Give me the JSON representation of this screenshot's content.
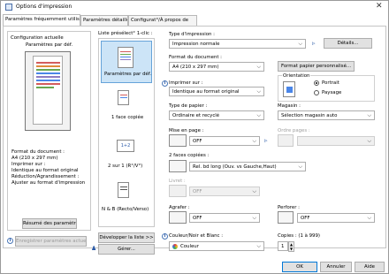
{
  "window": {
    "title": "Options d'impression"
  },
  "tabs": [
    {
      "label": "Paramètres fréquemment utilisés"
    },
    {
      "label": "Paramètres détaillés"
    },
    {
      "label": "Configurat°/À propos de"
    }
  ],
  "left_panel": {
    "heading": "Configuration actuelle",
    "preview_caption": "Paramètres par déf.",
    "summary_lines": [
      "Format du document :",
      "  A4 (210 x 297 mm)",
      "Imprimer sur :",
      "  Identique au format original",
      "Réduction/Agrandissement :",
      "  Ajuster au format d'impression"
    ],
    "summary_button": "Résumé des paramètres",
    "save_button": "Enregistrer paramètres actuels..."
  },
  "preset_list": {
    "heading": "Liste présélect° 1-clic :",
    "items": [
      {
        "label": "Paramètres par déf."
      },
      {
        "label": "1 face copiée"
      },
      {
        "label": "2 sur 1 (R°/V°)"
      },
      {
        "label": "N & B (Recto/Verso)"
      }
    ],
    "expand_button": "Développer la liste >>",
    "manage_button": "Gérer..."
  },
  "form": {
    "print_type": {
      "label": "Type d'impression :",
      "value": "Impression normale",
      "details_button": "Détails..."
    },
    "doc_size": {
      "label": "Format du document :",
      "value": "A4 (210 x 297 mm)",
      "custom_button": "Format papier personnalisé..."
    },
    "print_on": {
      "label": "Imprimer sur :",
      "value": "Identique au format original"
    },
    "orientation": {
      "label": "Orientation",
      "options": [
        "Portrait",
        "Paysage"
      ],
      "selected": "Portrait"
    },
    "paper_type": {
      "label": "Type de papier :",
      "value": "Ordinaire et recyclé"
    },
    "tray": {
      "label": "Magasin :",
      "value": "Sélection magasin auto"
    },
    "layout": {
      "label": "Mise en page :",
      "value": "OFF"
    },
    "page_order": {
      "label": "Ordre pages :"
    },
    "duplex": {
      "label": "2 faces copiées :",
      "value": "Rel. bd long (Ouv. vs Gauche,Haut)"
    },
    "staple": {
      "label": "Livret :",
      "value": "OFF"
    },
    "staple2": {
      "label": "Agrafer :",
      "value": "OFF"
    },
    "punch": {
      "label": "Perforer :",
      "value": "OFF"
    },
    "color": {
      "label": "Couleur/Noir et Blanc :",
      "value": "Couleur"
    },
    "copies": {
      "label": "Copies : (1 à 999)",
      "value": "1"
    }
  },
  "footer": {
    "ok": "OK",
    "cancel": "Annuler",
    "help": "Aide"
  },
  "icons": [
    "printer-icon",
    "info-icon",
    "arrow-right-icon",
    "chevron-down-icon",
    "document-icon",
    "color-icon"
  ]
}
